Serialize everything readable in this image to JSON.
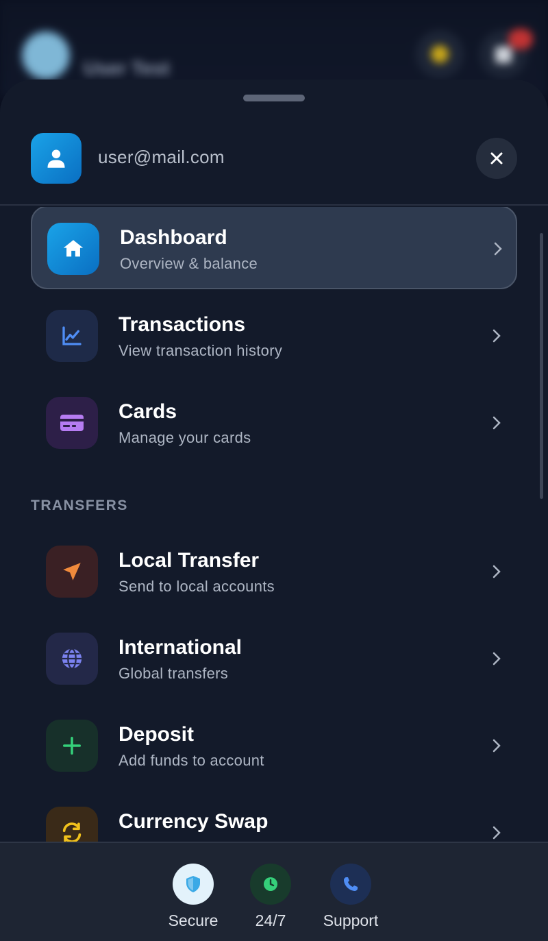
{
  "background": {
    "title": "User Test"
  },
  "user": {
    "email": "user@mail.com",
    "avatar_icon": "user-icon",
    "close_icon": "close-icon"
  },
  "menu": {
    "main": [
      {
        "title": "Dashboard",
        "subtitle": "Overview & balance",
        "icon": "home-icon",
        "active": true
      },
      {
        "title": "Transactions",
        "subtitle": "View transaction history",
        "icon": "chart-line-icon",
        "active": false
      },
      {
        "title": "Cards",
        "subtitle": "Manage your cards",
        "icon": "credit-card-icon",
        "active": false
      }
    ],
    "transfers_label": "TRANSFERS",
    "transfers": [
      {
        "title": "Local Transfer",
        "subtitle": "Send to local accounts",
        "icon": "send-icon"
      },
      {
        "title": "International",
        "subtitle": "Global transfers",
        "icon": "globe-icon"
      },
      {
        "title": "Deposit",
        "subtitle": "Add funds to account",
        "icon": "plus-icon"
      },
      {
        "title": "Currency Swap",
        "subtitle": "",
        "icon": "swap-icon"
      }
    ]
  },
  "footer": {
    "items": [
      {
        "label": "Secure",
        "icon": "shield-icon"
      },
      {
        "label": "24/7",
        "icon": "clock-icon"
      },
      {
        "label": "Support",
        "icon": "phone-icon"
      }
    ]
  },
  "colors": {
    "sheet_bg": "#131a2a",
    "accent_blue": "#1aa3e8",
    "footer_bg": "#1e2533"
  }
}
